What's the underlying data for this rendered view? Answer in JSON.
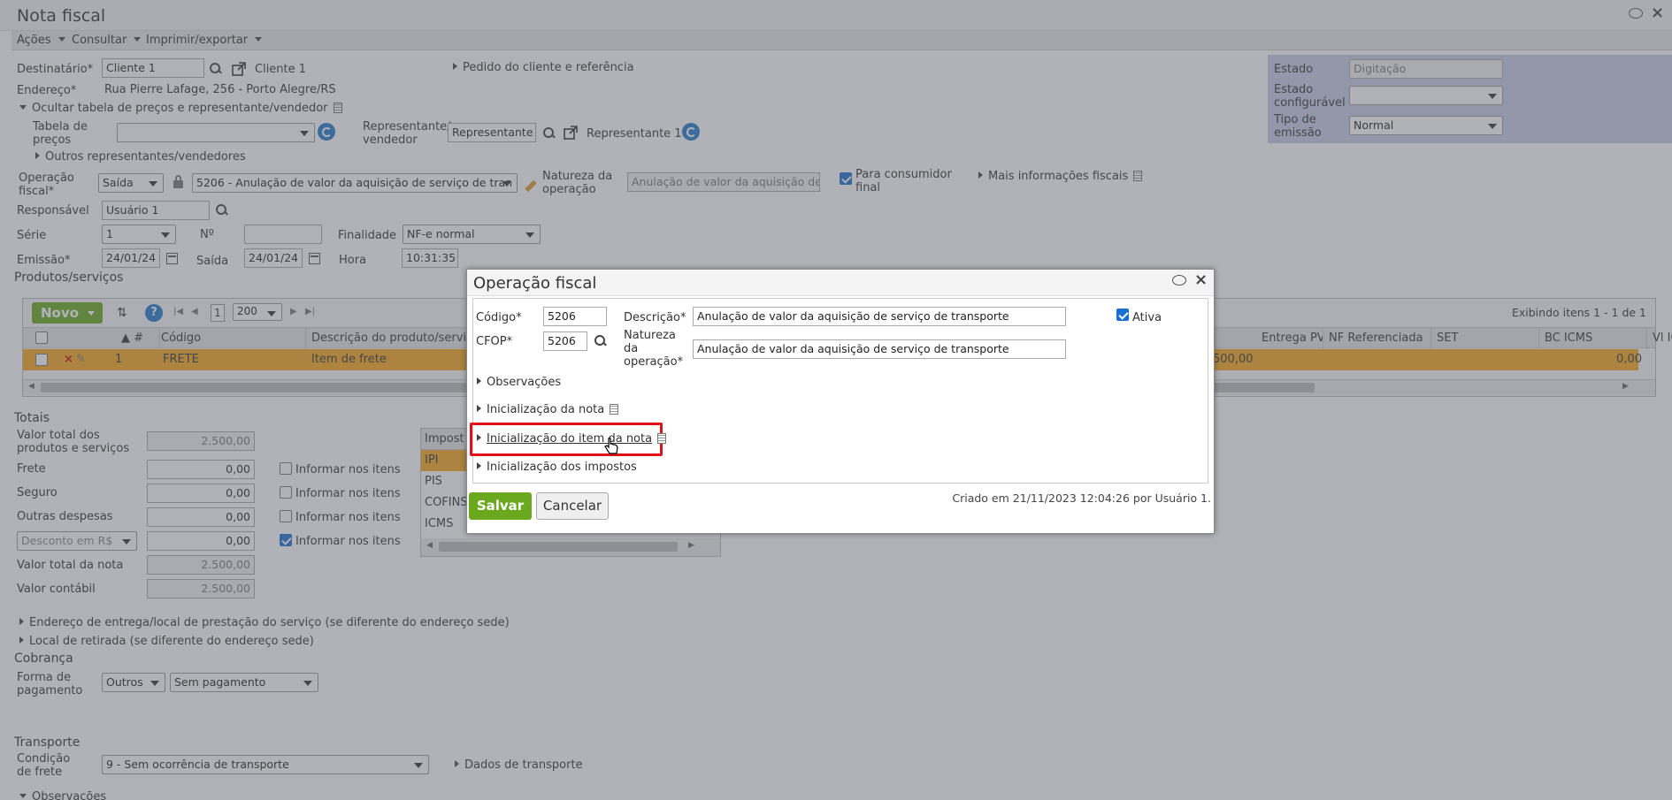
{
  "window": {
    "title": "Nota fiscal"
  },
  "menubar": {
    "acoes": "Ações",
    "consultar": "Consultar",
    "imprimir": "Imprimir/exportar"
  },
  "header": {
    "destinatario_label": "Destinatário*",
    "destinatario_value": "Cliente 1",
    "destinatario_link": "Cliente 1",
    "pedido_link": "Pedido do cliente e referência",
    "endereco_label": "Endereço*",
    "endereco_value": "Rua Pierre Lafage, 256 - Porto Alegre/RS",
    "ocultar_tabela": "Ocultar tabela de preços e representante/vendedor",
    "tabela_precos_label": "Tabela de preços",
    "representante_label": "Representante/ vendedor",
    "representante_value": "Representante 1",
    "representante_link": "Representante 1",
    "outros_representantes": "Outros representantes/vendedores",
    "operacao_label": "Operação fiscal*",
    "operacao_tipo": "Saída",
    "operacao_value": "5206 - Anulação de valor da aquisição de serviço de tran",
    "natureza_label": "Natureza da operação",
    "natureza_value": "Anulação de valor da aquisição de s",
    "consumidor_final": "Para consumidor final",
    "mais_info": "Mais informações fiscais",
    "responsavel_label": "Responsável",
    "responsavel_value": "Usuário 1",
    "serie_label": "Série",
    "serie_value": "1",
    "numero_label": "Nº",
    "finalidade_label": "Finalidade",
    "finalidade_value": "NF-e normal",
    "emissao_label": "Emissão*",
    "emissao_value": "24/01/24",
    "saida_label": "Saída",
    "saida_value": "24/01/24",
    "hora_label": "Hora",
    "hora_value": "10:31:35"
  },
  "status_panel": {
    "estado_label": "Estado",
    "estado_value": "Digitação",
    "estado_config_label": "Estado configurável",
    "tipo_emissao_label": "Tipo de emissão",
    "tipo_emissao_value": "Normal"
  },
  "produtos": {
    "section_title": "Produtos/serviços",
    "novo": "Novo",
    "page": "1",
    "per_page": "200",
    "exibindo": "Exibindo itens 1 - 1 de 1",
    "columns": [
      "#",
      "Código",
      "Descrição do produto/serviço",
      "Entrega PV",
      "NF Referenciada",
      "SET",
      "BC ICMS",
      "Vl ICMS"
    ],
    "row": {
      "num": "1",
      "codigo": "FRETE",
      "descricao": "Item de frete",
      "partial_value": "500,00",
      "bc_icms": "0,00"
    }
  },
  "totais": {
    "section_title": "Totais",
    "valor_total_label": "Valor total dos produtos e serviços",
    "valor_total": "2.500,00",
    "frete_label": "Frete",
    "frete": "0,00",
    "seguro_label": "Seguro",
    "seguro": "0,00",
    "outras_label": "Outras despesas",
    "outras": "0,00",
    "desconto_label": "Desconto em R$",
    "desconto": "0,00",
    "valor_nota_label": "Valor total da nota",
    "valor_nota": "2.500,00",
    "valor_contabil_label": "Valor contábil",
    "valor_contabil": "2.500,00",
    "informar": "Informar nos itens"
  },
  "impostos": {
    "header": "Impost",
    "items": [
      "IPI",
      "PIS",
      "COFINS",
      "ICMS"
    ]
  },
  "entrega": {
    "endereco": "Endereço de entrega/local de prestação do serviço (se diferente do endereço sede)",
    "retirada": "Local de retirada (se diferente do endereço sede)"
  },
  "cobranca": {
    "section_title": "Cobrança",
    "forma_label": "Forma de pagamento",
    "forma_value": "Outros",
    "pagamento_value": "Sem pagamento"
  },
  "transporte": {
    "section_title": "Transporte",
    "condicao_label": "Condição de frete",
    "condicao_value": "9 - Sem ocorrência de transporte",
    "dados_link": "Dados de transporte",
    "observacoes": "Observações"
  },
  "dialog": {
    "title": "Operação fiscal",
    "codigo_label": "Código*",
    "codigo_value": "5206",
    "descricao_label": "Descrição*",
    "descricao_value": "Anulação de valor da aquisição de serviço de transporte",
    "ativa_label": "Ativa",
    "cfop_label": "CFOP*",
    "cfop_value": "5206",
    "natureza_label": "Natureza da operação*",
    "natureza_value": "Anulação de valor da aquisição de serviço de transporte",
    "observacoes": "Observações",
    "init_nota": "Inicialização da nota",
    "init_item": "Inicialização do item da nota",
    "init_impostos": "Inicialização dos impostos",
    "salvar": "Salvar",
    "cancelar": "Cancelar",
    "criado": "Criado em 21/11/2023 12:04:26 por Usuário 1."
  },
  "colors": {
    "accent_green": "#6aa81e",
    "highlight_red": "#e0101a",
    "selected_row": "#f7a81b",
    "link_blue": "#1f79c9"
  }
}
